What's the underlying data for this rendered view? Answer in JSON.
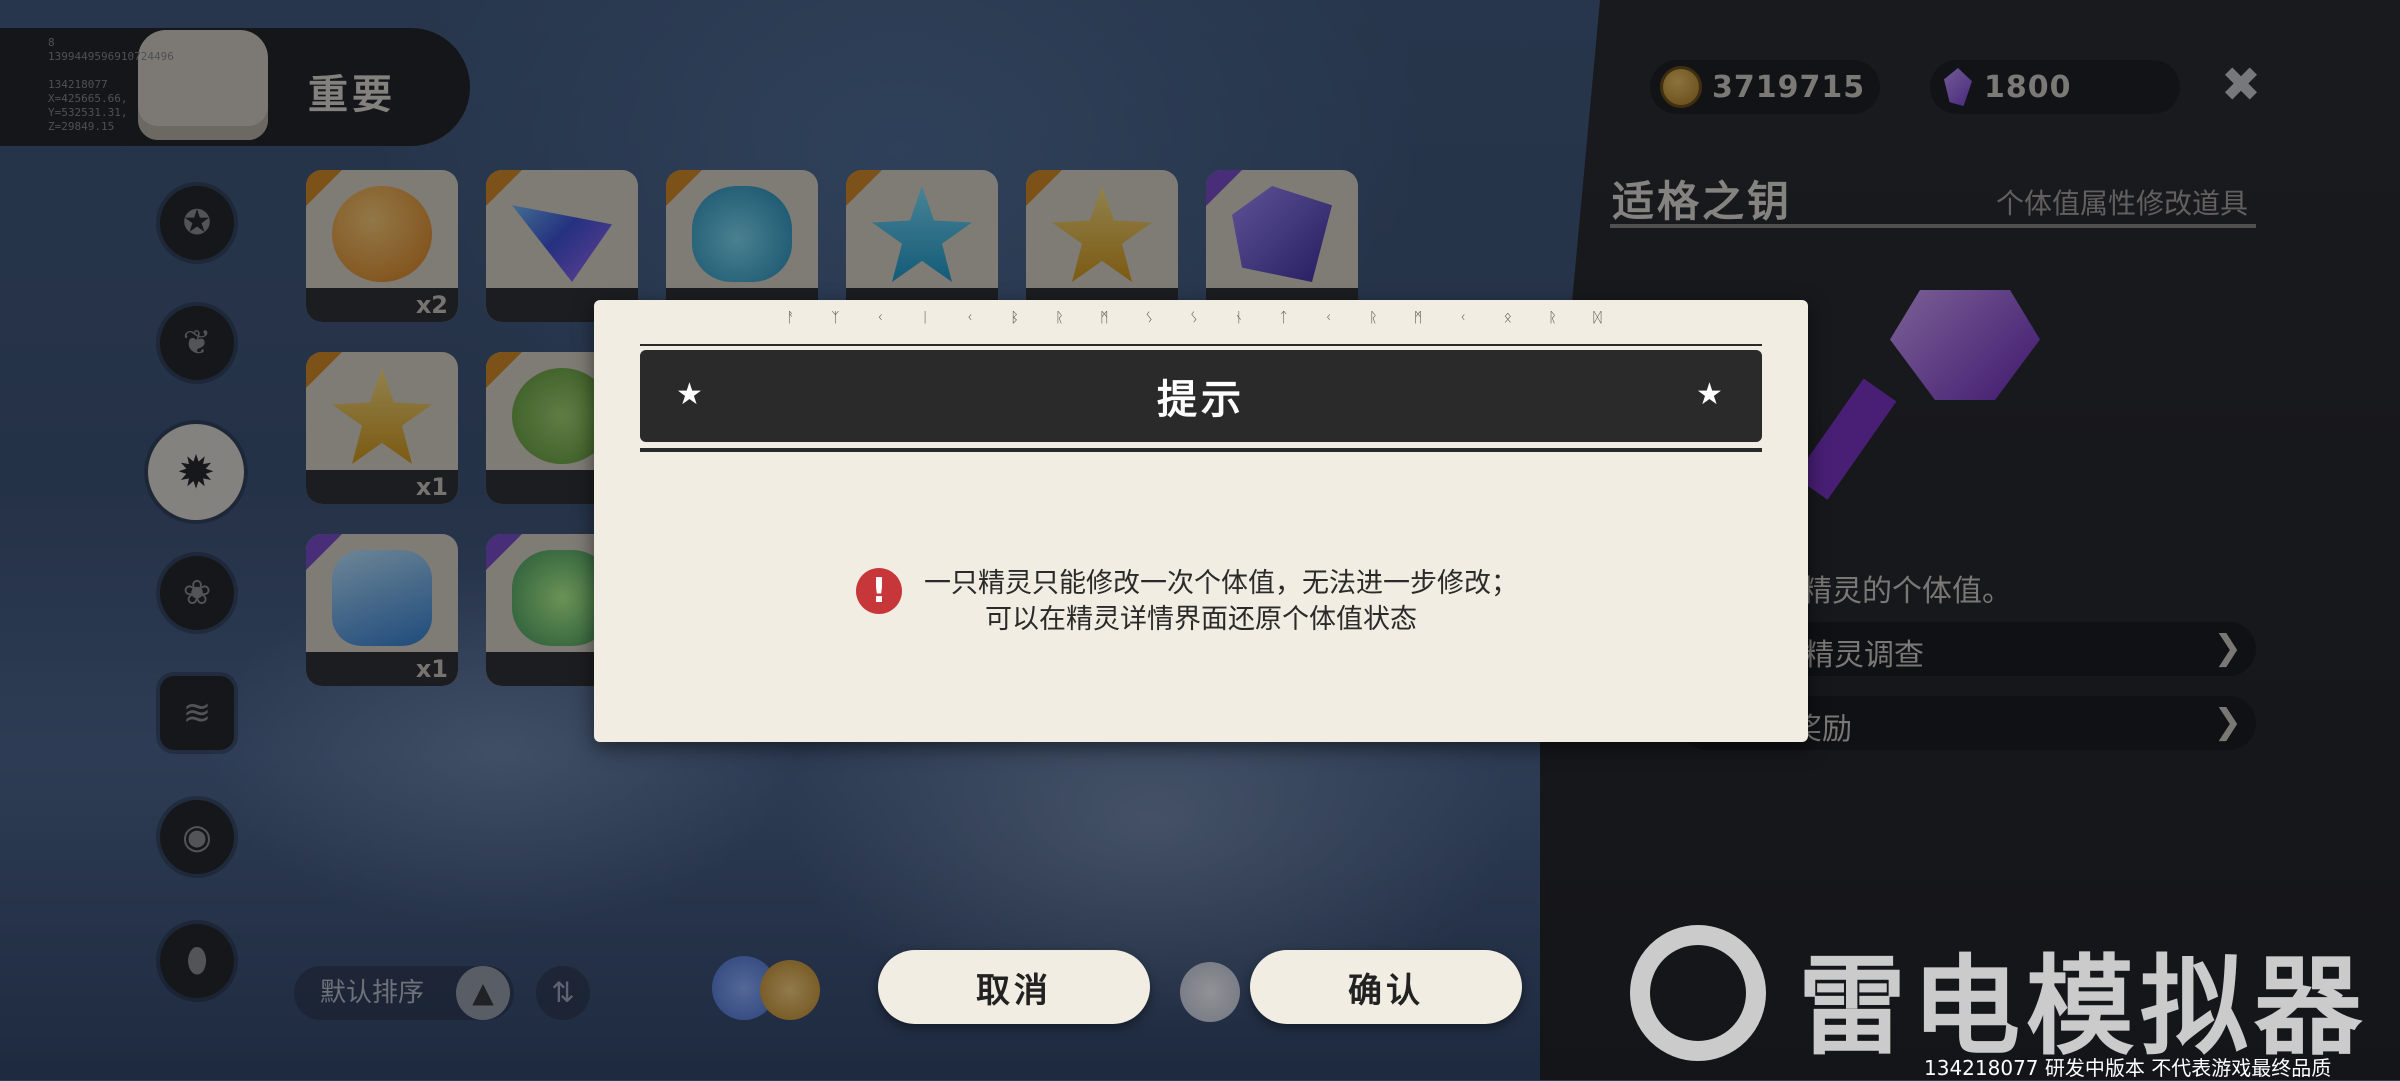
{
  "top_bar": {
    "category_title": "重要",
    "debug_text": "8\n1399449596910724496\n\n134218077\nX=425665.66,\nY=532531.31,\nZ=29849.15"
  },
  "sidebar_icons": [
    "star-icon",
    "leaf-icon",
    "badge-icon",
    "flower-icon",
    "map-icon",
    "ball-icon",
    "acorn-icon"
  ],
  "items": [
    {
      "count": "x2",
      "rarity": "orange"
    },
    {
      "count": "",
      "rarity": "orange"
    },
    {
      "count": "",
      "rarity": "orange"
    },
    {
      "count": "",
      "rarity": "orange"
    },
    {
      "count": "",
      "rarity": "orange"
    },
    {
      "count": "",
      "rarity": "purple"
    },
    {
      "count": "x1",
      "rarity": "orange"
    },
    {
      "count": "",
      "rarity": "orange"
    },
    {
      "count": "x1",
      "rarity": "purple"
    },
    {
      "count": "",
      "rarity": "purple"
    }
  ],
  "bottom_controls": {
    "sort_label": "默认排序"
  },
  "currency": {
    "coins": "3719715",
    "gems": "1800"
  },
  "detail": {
    "item_name": "适格之钥",
    "item_type": "个体值属性修改道具",
    "desc_fragment": "改精灵的个体值。",
    "link1": "精灵调查",
    "link2": "奖励"
  },
  "modal": {
    "runes": "ᚨ ᛉ ᚲ ᛁ ᚲ  ᛒ ᚱ ᛗ ᛊ ᛊ ᚾ ᛏ ᚲ  ᚱ ᛗ ᚲ ᛟ ᚱ ᛞ",
    "title": "提示",
    "message_line1": "一只精灵只能修改一次个体值，无法进一步修改；",
    "message_line2": "可以在精灵详情界面还原个体值状态",
    "cancel_label": "取消",
    "confirm_label": "确认"
  },
  "watermark": {
    "brand": "雷电模拟器",
    "note": "134218077  研发中版本 不代表游戏最终品质"
  },
  "colors": {
    "modal_bg": "#f2ede2",
    "header_dark": "#2a2a2a",
    "warn_red": "#c7373a",
    "rarity_orange": "#d98a1a",
    "rarity_purple": "#7a47c8"
  }
}
